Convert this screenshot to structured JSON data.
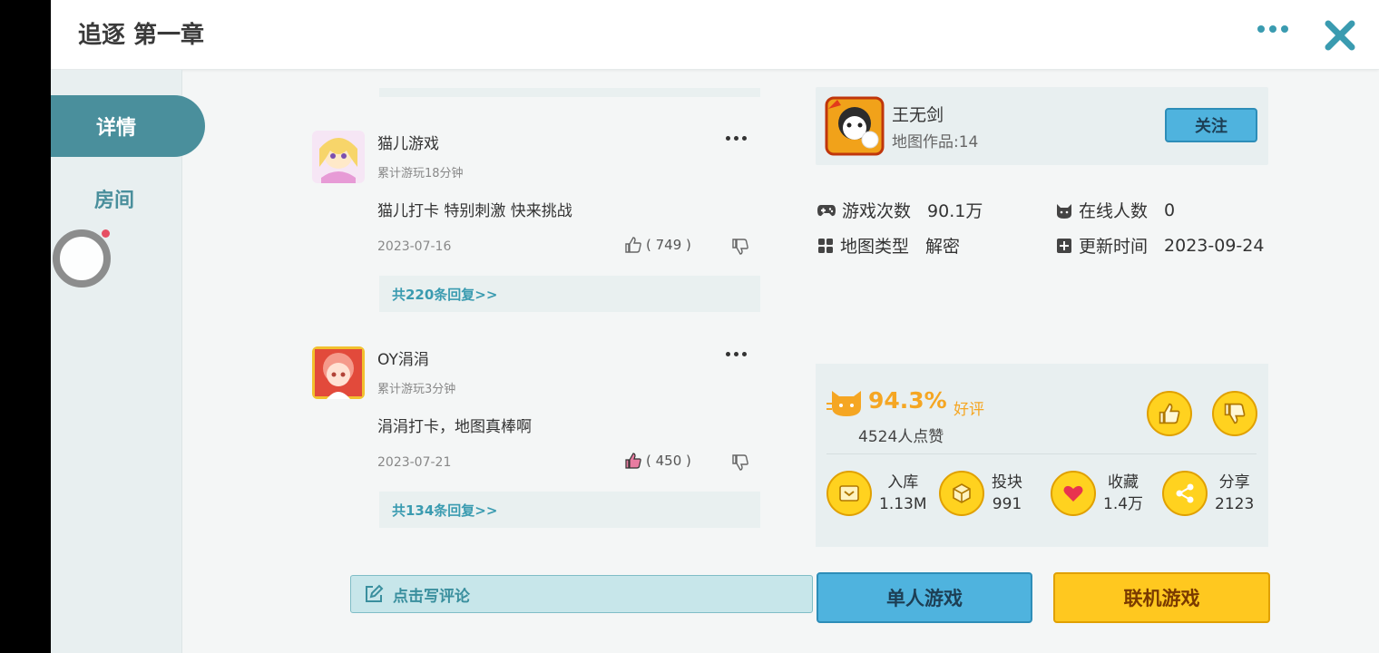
{
  "header": {
    "title": "追逐 第一章"
  },
  "sidebar": {
    "tabs": [
      {
        "label": "详情"
      },
      {
        "label": "房间"
      }
    ]
  },
  "comments": [
    {
      "user": "猫儿游戏",
      "playtime": "累计游玩18分钟",
      "text": "猫儿打卡 特别刺激 快来挑战",
      "date": "2023-07-16",
      "likes": "( 749 )",
      "replies": "共220条回复>>"
    },
    {
      "user": "OY涓涓",
      "playtime": "累计游玩3分钟",
      "text": "涓涓打卡，地图真棒啊",
      "date": "2023-07-21",
      "likes": "( 450 )",
      "replies": "共134条回复>>"
    }
  ],
  "write_comment": {
    "label": "点击写评论"
  },
  "author": {
    "name": "王无剑",
    "works": "地图作品:14",
    "follow_label": "关注"
  },
  "stats": {
    "plays": {
      "label": "游戏次数",
      "value": "90.1万"
    },
    "online": {
      "label": "在线人数",
      "value": "0"
    },
    "map_type": {
      "label": "地图类型",
      "value": "解密"
    },
    "updated": {
      "label": "更新时间",
      "value": "2023-09-24"
    }
  },
  "rating": {
    "percent": "94.3%",
    "good_label": "好评",
    "likes_text": "4524人点赞"
  },
  "actions": [
    {
      "label": "入库",
      "value": "1.13M",
      "icon": "inbox-icon"
    },
    {
      "label": "投块",
      "value": "991",
      "icon": "block-icon"
    },
    {
      "label": "收藏",
      "value": "1.4万",
      "icon": "heart-icon"
    },
    {
      "label": "分享",
      "value": "2123",
      "icon": "share-icon"
    }
  ],
  "buttons": {
    "single": "单人游戏",
    "multi": "联机游戏"
  },
  "colors": {
    "accent": "#4a8f9c",
    "link": "#3a9bb0",
    "gold": "#f5a623",
    "blue_button": "#4fb3de",
    "yellow_button": "#ffc81f"
  }
}
